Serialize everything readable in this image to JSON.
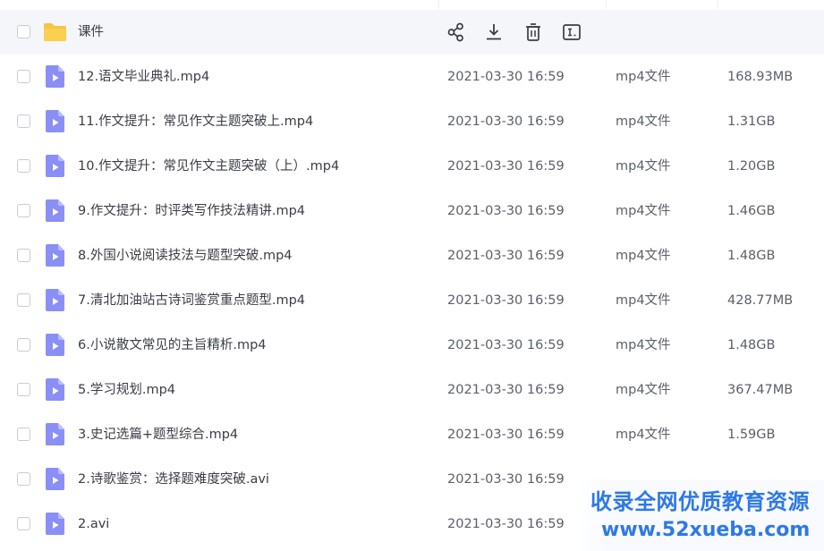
{
  "colors": {
    "accent": "#4d7cf2",
    "folder": "#f7c443",
    "video_icon": "#8a8ff5",
    "row_selected": "#f5f6fa",
    "watermark": "#2d79e6"
  },
  "toolbar": {
    "share_icon": "share-icon",
    "download_icon": "download-icon",
    "delete_icon": "trash-icon",
    "rename_icon": "rename-icon"
  },
  "folder_row": {
    "name": "课件",
    "icon": "folder-icon"
  },
  "files": [
    {
      "name": "12.语文毕业典礼.mp4",
      "date": "2021-03-30 16:59",
      "type": "mp4文件",
      "size": "168.93MB"
    },
    {
      "name": "11.作文提升：常见作文主题突破上.mp4",
      "date": "2021-03-30 16:59",
      "type": "mp4文件",
      "size": "1.31GB"
    },
    {
      "name": "10.作文提升：常见作文主题突破（上）.mp4",
      "date": "2021-03-30 16:59",
      "type": "mp4文件",
      "size": "1.20GB"
    },
    {
      "name": "9.作文提升：时评类写作技法精讲.mp4",
      "date": "2021-03-30 16:59",
      "type": "mp4文件",
      "size": "1.46GB"
    },
    {
      "name": "8.外国小说阅读技法与题型突破.mp4",
      "date": "2021-03-30 16:59",
      "type": "mp4文件",
      "size": "1.48GB"
    },
    {
      "name": "7.清北加油站古诗词鉴赏重点题型.mp4",
      "date": "2021-03-30 16:59",
      "type": "mp4文件",
      "size": "428.77MB"
    },
    {
      "name": "6.小说散文常见的主旨精析.mp4",
      "date": "2021-03-30 16:59",
      "type": "mp4文件",
      "size": "1.48GB"
    },
    {
      "name": "5.学习规划.mp4",
      "date": "2021-03-30 16:59",
      "type": "mp4文件",
      "size": "367.47MB"
    },
    {
      "name": "3.史记选篇+题型综合.mp4",
      "date": "2021-03-30 16:59",
      "type": "mp4文件",
      "size": "1.59GB"
    },
    {
      "name": "2.诗歌鉴赏：选择题难度突破.avi",
      "date": "2021-03-30 16:59",
      "type": "",
      "size": ""
    },
    {
      "name": "2.avi",
      "date": "2021-03-30 16:59",
      "type": "",
      "size": ""
    }
  ],
  "watermark": {
    "line1": "收录全网优质教育资源",
    "line2": "www.52xueba.com"
  }
}
